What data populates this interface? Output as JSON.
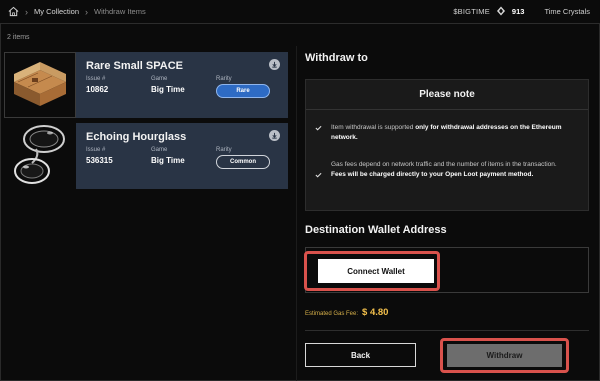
{
  "header": {
    "breadcrumbs": [
      "My Collection",
      "Withdraw Items"
    ],
    "token_label": "$BIGTIME",
    "token_amount": "913",
    "crystals_label": "Time Crystals"
  },
  "items_count": "2 items",
  "items": [
    {
      "name": "Rare Small SPACE",
      "issue_label": "Issue #",
      "issue": "10862",
      "game_label": "Game",
      "game": "Big Time",
      "rarity_label": "Rarity",
      "rarity": "Rare"
    },
    {
      "name": "Echoing Hourglass",
      "issue_label": "Issue #",
      "issue": "536315",
      "game_label": "Game",
      "game": "Big Time",
      "rarity_label": "Rarity",
      "rarity": "Common"
    }
  ],
  "withdraw": {
    "title": "Withdraw to",
    "note_title": "Please note",
    "note1_plain": "Item withdrawal is supported ",
    "note1_bold": "only for withdrawal addresses on the Ethereum network.",
    "note2_plain": "Gas fees depend on network traffic and the number of items in the transaction. ",
    "note2_bold": "Fees will be charged directly to your Open Loot payment method."
  },
  "destination": {
    "title": "Destination Wallet Address",
    "connect_label": "Connect Wallet"
  },
  "gas": {
    "label": "Estimated Gas Fee:",
    "value": "$ 4.80"
  },
  "actions": {
    "back_label": "Back",
    "withdraw_label": "Withdraw"
  },
  "colors": {
    "card_bg": "#293445",
    "rare_pill": "#2e6bc4",
    "gas": "#f3c04c",
    "highlight": "#d9524c"
  }
}
